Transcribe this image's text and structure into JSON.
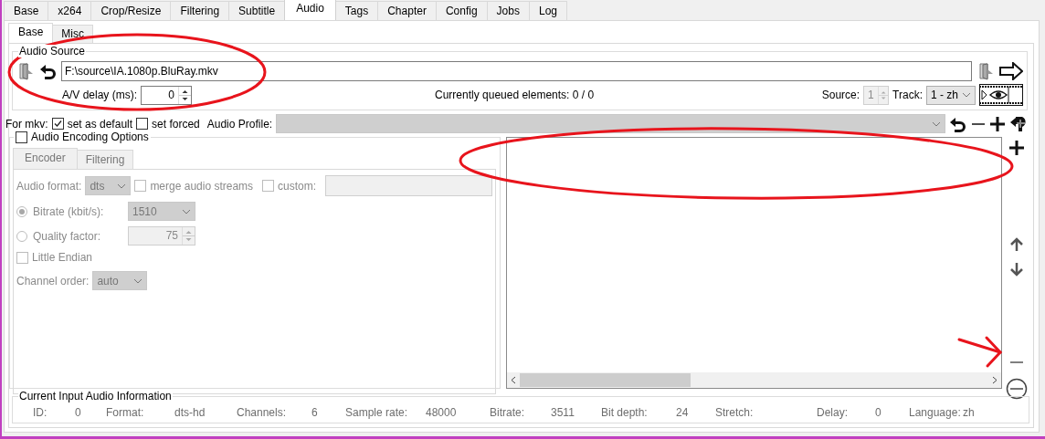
{
  "tabs": [
    {
      "label": "Base",
      "selected": false
    },
    {
      "label": "x264",
      "selected": false
    },
    {
      "label": "Crop/Resize",
      "selected": false
    },
    {
      "label": "Filtering",
      "selected": false
    },
    {
      "label": "Subtitle",
      "selected": false
    },
    {
      "label": "Audio",
      "selected": true
    },
    {
      "label": "Tags",
      "selected": false
    },
    {
      "label": "Chapter",
      "selected": false
    },
    {
      "label": "Config",
      "selected": false
    },
    {
      "label": "Jobs",
      "selected": false
    },
    {
      "label": "Log",
      "selected": false
    }
  ],
  "subtabs": [
    {
      "label": "Base",
      "selected": true
    },
    {
      "label": "Misc",
      "selected": false
    }
  ],
  "audio_source": {
    "title": "Audio Source",
    "path": "F:\\source\\IA.1080p.BluRay.mkv",
    "av_delay_label": "A/V delay (ms):",
    "av_delay": "0",
    "queued": "Currently queued elements: 0 / 0",
    "source_label": "Source:",
    "source": "1",
    "source_disabled": true,
    "track_label": "Track:",
    "track": "1 - zh"
  },
  "mkv": {
    "label": "For mkv:",
    "options": [
      {
        "label": "set as default",
        "checked": true
      },
      {
        "label": "set forced",
        "checked": false
      }
    ],
    "profile_label": "Audio Profile:",
    "profile_disabled": true
  },
  "encoding": {
    "label": "Audio Encoding Options",
    "checked": false,
    "tabs": [
      {
        "label": "Encoder",
        "selected": true
      },
      {
        "label": "Filtering",
        "selected": false
      }
    ],
    "format_label": "Audio format:",
    "format": "dts",
    "merge": {
      "label": "merge audio streams",
      "checked": false
    },
    "custom": {
      "label": "custom:",
      "checked": false
    },
    "modes": [
      {
        "label": "Bitrate (kbit/s):",
        "selected": true,
        "kind": "combo",
        "value": "1510"
      },
      {
        "label": "Quality factor:",
        "selected": false,
        "kind": "spin",
        "value": "75"
      }
    ],
    "little_endian": {
      "label": "Little Endian",
      "checked": false
    },
    "channel_order_label": "Channel order:",
    "channel_order": "auto"
  },
  "info": {
    "title": "Current Input Audio Information",
    "fields": [
      {
        "label": "ID:",
        "value": "0"
      },
      {
        "label": "Format:",
        "value": "dts-hd"
      },
      {
        "label": "Channels:",
        "value": "6"
      },
      {
        "label": "Sample rate:",
        "value": "48000"
      },
      {
        "label": "Bitrate:",
        "value": "3511"
      },
      {
        "label": "Bit depth:",
        "value": "24"
      },
      {
        "label": "Stretch:"
      },
      {
        "label": "Delay:",
        "value": "0"
      },
      {
        "label": "Language:",
        "value": "zh"
      }
    ]
  }
}
